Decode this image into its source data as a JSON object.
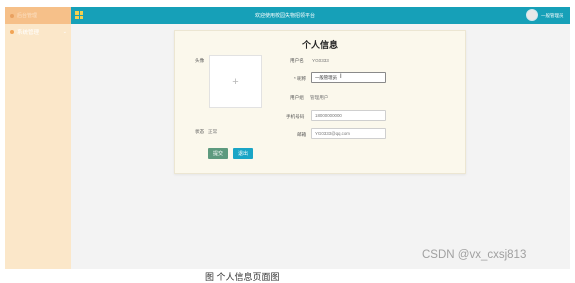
{
  "header": {
    "sidebar_title": "后台管理",
    "site_title": "欢迎使用校园失物招领平台",
    "user_name": "一般管理员"
  },
  "sidebar": {
    "items": [
      {
        "label": "系统管理",
        "chevron": "⌄"
      }
    ]
  },
  "profile": {
    "title": "个人信息",
    "avatar_label": "头像",
    "upload_icon": "+",
    "status_label": "状态",
    "status_value": "正常",
    "username_label": "用户名",
    "username_value": "YG0333",
    "nickname_label": "* 昵称",
    "nickname_value": "一般管理员",
    "role_label": "用户组",
    "role_value": "管理用户",
    "phone_label": "手机号码",
    "phone_value": "18000000000",
    "email_label": "邮箱",
    "email_value": "YG0333@qq.com",
    "submit_label": "提交",
    "logout_label": "退出"
  },
  "watermark": "CSDN @vx_cxsj813",
  "caption": "图 个人信息页面图",
  "colors": {
    "topbar": "#16a0b8",
    "sidebar": "#fbe7c9",
    "card": "#fbf8ec",
    "submit": "#5d9a7e",
    "logout": "#1aa5c6"
  }
}
